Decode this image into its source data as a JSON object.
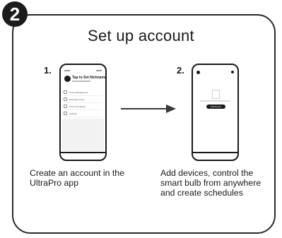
{
  "step_number": "2",
  "title": "Set up account",
  "steps": [
    {
      "number": "1.",
      "phone": {
        "profile_name": "Tap to Set Nickname",
        "menu_items": [
          "Home Management",
          "Message Center",
          "FAQ & Feedback",
          "Settings"
        ]
      },
      "description": "Create an account in the UltraPro app"
    },
    {
      "number": "2.",
      "phone": {
        "button_label": "Add Device"
      },
      "description": "Add devices, control the smart bulb from anywhere and create schedules"
    }
  ]
}
